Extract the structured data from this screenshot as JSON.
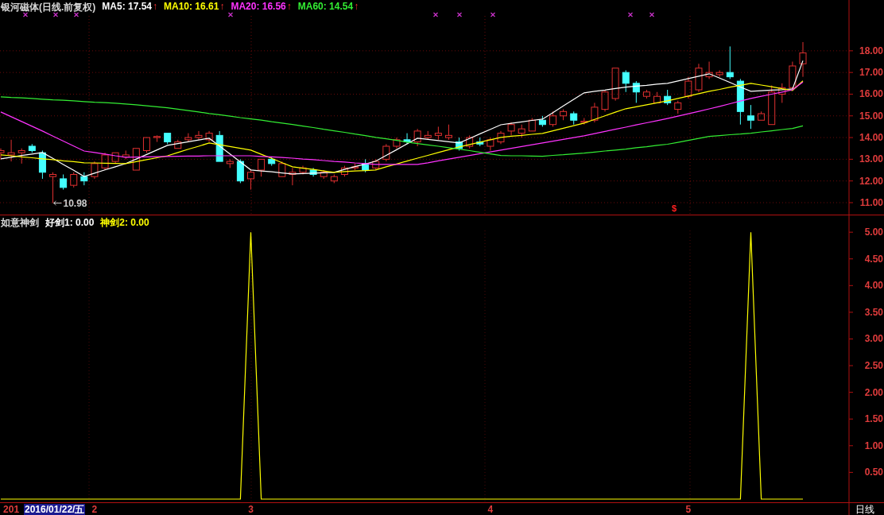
{
  "stock_panel": {
    "title": "银河磁体(日线.前复权)",
    "indicators": [
      {
        "label": "MA5: 17.54",
        "arrow": "↑",
        "color": "#ffffff"
      },
      {
        "label": "MA10: 16.61",
        "arrow": "↑",
        "color": "#ffff00"
      },
      {
        "label": "MA20: 16.56",
        "arrow": "↑",
        "color": "#ff33ff"
      },
      {
        "label": "MA60: 14.54",
        "arrow": "↑",
        "color": "#33ee33"
      }
    ],
    "chart_data": {
      "type": "candlestick",
      "grid": true,
      "ylim": [
        10.45,
        20.34
      ],
      "categories": [
        null,
        null,
        null,
        null,
        null,
        null,
        null,
        null,
        null,
        null,
        null,
        null,
        null,
        null,
        null,
        null,
        null,
        null,
        null,
        null,
        null,
        null,
        null,
        null,
        null,
        null,
        null,
        null,
        null,
        null,
        null,
        null,
        null,
        null,
        null,
        null,
        null,
        null,
        null,
        null,
        null,
        null,
        null,
        null,
        null,
        null,
        null,
        null,
        null,
        null,
        null,
        null,
        null,
        null,
        null,
        null,
        null,
        null,
        null,
        null,
        null,
        null,
        null,
        null,
        null,
        null,
        null,
        null,
        null,
        null,
        null,
        null,
        null,
        null,
        null,
        null,
        null,
        null
      ],
      "yticks": [
        {
          "value": 11,
          "label": "11.00"
        },
        {
          "value": 12,
          "label": "12.00"
        },
        {
          "value": 13,
          "label": "13.00"
        },
        {
          "value": 14,
          "label": "14.00"
        },
        {
          "value": 15,
          "label": "15.00"
        },
        {
          "value": 16,
          "label": "16.00"
        },
        {
          "value": 17,
          "label": "17.00"
        },
        {
          "value": 18,
          "label": "18.00"
        }
      ],
      "ohlc": [
        [
          13.3,
          13.5,
          13.0,
          13.4
        ],
        [
          13.2,
          13.9,
          12.9,
          13.3
        ],
        [
          13.3,
          13.5,
          12.8,
          13.4
        ],
        [
          13.6,
          13.7,
          13.3,
          13.4
        ],
        [
          13.3,
          13.4,
          12.1,
          12.4
        ],
        [
          12.2,
          12.4,
          10.98,
          12.3
        ],
        [
          12.1,
          12.3,
          11.6,
          11.7
        ],
        [
          11.8,
          12.4,
          11.7,
          12.3
        ],
        [
          12.2,
          12.4,
          11.8,
          12.0
        ],
        [
          12.2,
          12.9,
          12.1,
          12.8
        ],
        [
          12.6,
          13.3,
          12.5,
          13.2
        ],
        [
          12.9,
          13.3,
          12.8,
          13.3
        ],
        [
          13.1,
          13.4,
          13.0,
          13.2
        ],
        [
          12.5,
          13.5,
          12.5,
          13.5
        ],
        [
          13.4,
          14.0,
          13.3,
          14.0
        ],
        [
          14.0,
          14.1,
          13.8,
          14.05
        ],
        [
          14.2,
          14.2,
          13.7,
          13.8
        ],
        [
          13.5,
          13.9,
          13.5,
          13.8
        ],
        [
          13.9,
          14.2,
          13.8,
          14.0
        ],
        [
          14.0,
          14.3,
          13.9,
          14.1
        ],
        [
          13.9,
          14.3,
          13.8,
          14.2
        ],
        [
          14.1,
          14.3,
          12.9,
          12.9
        ],
        [
          12.8,
          13.0,
          12.6,
          12.9
        ],
        [
          12.9,
          13.0,
          11.9,
          12.0
        ],
        [
          12.1,
          12.5,
          11.6,
          12.4
        ],
        [
          12.5,
          13.0,
          12.2,
          13.0
        ],
        [
          13.0,
          13.1,
          12.7,
          12.8
        ],
        [
          12.2,
          12.9,
          12.2,
          12.8
        ],
        [
          12.3,
          12.6,
          11.8,
          12.4
        ],
        [
          12.4,
          12.7,
          12.3,
          12.6
        ],
        [
          12.5,
          12.6,
          12.2,
          12.3
        ],
        [
          12.2,
          12.5,
          12.1,
          12.4
        ],
        [
          12.0,
          12.3,
          11.9,
          12.2
        ],
        [
          12.3,
          12.7,
          12.2,
          12.6
        ],
        [
          12.6,
          12.8,
          12.5,
          12.65
        ],
        [
          12.8,
          13.0,
          12.4,
          12.5
        ],
        [
          12.6,
          13.0,
          12.5,
          12.9
        ],
        [
          13.0,
          13.7,
          12.9,
          13.6
        ],
        [
          13.6,
          14.0,
          13.5,
          13.9
        ],
        [
          13.9,
          14.2,
          13.7,
          13.8
        ],
        [
          13.8,
          14.4,
          13.6,
          14.3
        ],
        [
          14.0,
          14.3,
          13.9,
          14.1
        ],
        [
          14.1,
          14.5,
          13.9,
          14.2
        ],
        [
          14.0,
          14.6,
          13.9,
          14.1
        ],
        [
          13.8,
          14.0,
          13.4,
          13.5
        ],
        [
          13.6,
          14.1,
          13.5,
          14.0
        ],
        [
          13.8,
          14.0,
          13.6,
          13.7
        ],
        [
          13.6,
          14.0,
          13.4,
          13.9
        ],
        [
          13.8,
          14.3,
          13.7,
          14.2
        ],
        [
          14.3,
          14.7,
          14.1,
          14.6
        ],
        [
          14.2,
          14.6,
          14.0,
          14.4
        ],
        [
          14.3,
          14.9,
          14.3,
          14.8
        ],
        [
          14.8,
          15.0,
          14.5,
          14.6
        ],
        [
          14.6,
          15.2,
          14.5,
          15.0
        ],
        [
          15.0,
          15.3,
          14.8,
          15.2
        ],
        [
          15.1,
          15.2,
          14.6,
          14.8
        ],
        [
          14.7,
          14.9,
          14.6,
          14.75
        ],
        [
          14.8,
          15.6,
          14.7,
          15.4
        ],
        [
          15.3,
          16.2,
          15.2,
          16.1
        ],
        [
          15.8,
          17.2,
          15.7,
          17.2
        ],
        [
          17.0,
          17.1,
          16.1,
          16.5
        ],
        [
          16.5,
          16.6,
          15.6,
          16.1
        ],
        [
          15.9,
          16.2,
          15.8,
          16.1
        ],
        [
          15.6,
          16.1,
          15.6,
          15.9
        ],
        [
          15.9,
          16.2,
          15.5,
          15.6
        ],
        [
          15.3,
          15.7,
          15.1,
          15.6
        ],
        [
          15.9,
          16.8,
          15.8,
          16.6
        ],
        [
          16.2,
          17.4,
          16.1,
          17.2
        ],
        [
          16.8,
          17.5,
          16.7,
          17.0
        ],
        [
          16.9,
          17.1,
          16.8,
          17.0
        ],
        [
          17.0,
          18.2,
          16.7,
          16.8
        ],
        [
          16.6,
          16.7,
          14.6,
          15.2
        ],
        [
          15.0,
          15.5,
          14.4,
          14.8
        ],
        [
          14.8,
          15.2,
          14.8,
          15.1
        ],
        [
          14.6,
          16.4,
          14.6,
          16.1
        ],
        [
          16.0,
          16.5,
          15.6,
          16.3
        ],
        [
          16.3,
          17.5,
          16.2,
          17.3
        ],
        [
          17.4,
          18.4,
          16.8,
          17.9
        ]
      ],
      "series": [
        {
          "type": "line",
          "color": "#ffffff",
          "values": [
            13.02,
            13.09,
            13.17,
            13.24,
            13.31,
            13.04,
            12.76,
            12.49,
            12.21,
            12.36,
            12.51,
            12.65,
            12.8,
            13.01,
            13.22,
            13.43,
            13.64,
            13.72,
            13.81,
            13.89,
            13.97,
            13.61,
            13.24,
            12.88,
            12.51,
            12.46,
            12.42,
            12.37,
            12.32,
            12.34,
            12.36,
            12.38,
            12.4,
            12.53,
            12.66,
            12.78,
            12.91,
            13.18,
            13.44,
            13.71,
            13.97,
            13.92,
            13.86,
            13.81,
            13.75,
            13.96,
            14.17,
            14.38,
            14.59,
            14.66,
            14.72,
            14.79,
            14.85,
            15.15,
            15.46,
            15.76,
            16.06,
            16.13,
            16.19,
            16.26,
            16.32,
            16.37,
            16.41,
            16.46,
            16.5,
            16.61,
            16.72,
            16.83,
            16.94,
            16.74,
            16.54,
            16.33,
            16.13,
            16.16,
            16.19,
            16.21,
            16.24,
            17.54
          ]
        },
        {
          "type": "line",
          "color": "#ffff00",
          "values": [
            13.2,
            13.16,
            13.11,
            13.07,
            13.02,
            12.98,
            12.93,
            12.89,
            12.84,
            12.83,
            12.82,
            12.81,
            12.8,
            12.89,
            12.98,
            13.07,
            13.16,
            13.31,
            13.46,
            13.6,
            13.75,
            13.67,
            13.59,
            13.5,
            13.42,
            13.23,
            13.04,
            12.84,
            12.65,
            12.59,
            12.53,
            12.46,
            12.4,
            12.43,
            12.46,
            12.48,
            12.51,
            12.65,
            12.78,
            12.92,
            13.05,
            13.18,
            13.31,
            13.44,
            13.57,
            13.68,
            13.79,
            13.9,
            14.01,
            14.06,
            14.1,
            14.15,
            14.19,
            14.31,
            14.43,
            14.55,
            14.67,
            14.84,
            15.0,
            15.17,
            15.33,
            15.42,
            15.51,
            15.6,
            15.69,
            15.8,
            15.91,
            16.02,
            16.13,
            16.22,
            16.32,
            16.41,
            16.5,
            16.42,
            16.34,
            16.25,
            16.17,
            16.61
          ]
        },
        {
          "type": "line",
          "color": "#ff33ff",
          "values": [
            15.18,
            14.96,
            14.74,
            14.52,
            14.3,
            14.07,
            13.84,
            13.61,
            13.38,
            13.31,
            13.24,
            13.16,
            13.09,
            13.1,
            13.11,
            13.12,
            13.13,
            13.14,
            13.15,
            13.15,
            13.16,
            13.16,
            13.16,
            13.16,
            13.16,
            13.13,
            13.11,
            13.08,
            13.05,
            13.01,
            12.98,
            12.94,
            12.9,
            12.87,
            12.83,
            12.8,
            12.76,
            12.76,
            12.76,
            12.76,
            12.76,
            12.84,
            12.93,
            13.01,
            13.09,
            13.17,
            13.26,
            13.34,
            13.42,
            13.5,
            13.59,
            13.67,
            13.75,
            13.83,
            13.92,
            14.0,
            14.08,
            14.18,
            14.28,
            14.38,
            14.48,
            14.58,
            14.68,
            14.78,
            14.88,
            14.99,
            15.1,
            15.21,
            15.32,
            15.44,
            15.56,
            15.68,
            15.8,
            15.9,
            16.0,
            16.1,
            16.2,
            16.56
          ]
        },
        {
          "type": "line",
          "color": "#33ee33",
          "values": [
            15.88,
            15.85,
            15.83,
            15.8,
            15.77,
            15.74,
            15.72,
            15.69,
            15.66,
            15.63,
            15.61,
            15.58,
            15.55,
            15.51,
            15.46,
            15.42,
            15.37,
            15.31,
            15.24,
            15.18,
            15.11,
            15.05,
            14.99,
            14.92,
            14.86,
            14.8,
            14.73,
            14.67,
            14.6,
            14.53,
            14.46,
            14.38,
            14.31,
            14.24,
            14.16,
            14.09,
            14.01,
            13.94,
            13.87,
            13.79,
            13.72,
            13.66,
            13.6,
            13.53,
            13.47,
            13.4,
            13.32,
            13.25,
            13.17,
            13.16,
            13.16,
            13.15,
            13.14,
            13.18,
            13.21,
            13.25,
            13.28,
            13.33,
            13.38,
            13.42,
            13.47,
            13.53,
            13.58,
            13.64,
            13.69,
            13.78,
            13.87,
            13.96,
            14.05,
            14.09,
            14.13,
            14.16,
            14.2,
            14.26,
            14.31,
            14.37,
            14.42,
            14.54
          ]
        }
      ],
      "annotations": [
        "10.98"
      ]
    },
    "signal_mark": "$"
  },
  "indicator_panel": {
    "title": "如意神剑",
    "values": [
      {
        "label": "好剑1: 0.00",
        "color": "#ffffff"
      },
      {
        "label": "神剑2: 0.00",
        "color": "#ffff00"
      }
    ],
    "chart_data": {
      "type": "line",
      "ylim": [
        -0.06,
        5.33
      ],
      "categories": [
        null,
        "201",
        null,
        null,
        null,
        null,
        null,
        null,
        null,
        "2",
        null,
        null,
        null,
        null,
        null,
        null,
        null,
        null,
        null,
        null,
        null,
        null,
        null,
        null,
        "3",
        null,
        null,
        null,
        null,
        null,
        null,
        null,
        null,
        null,
        null,
        null,
        null,
        null,
        null,
        null,
        null,
        null,
        null,
        null,
        null,
        null,
        null,
        "4",
        null,
        null,
        null,
        null,
        null,
        null,
        null,
        null,
        null,
        null,
        null,
        null,
        null,
        null,
        null,
        null,
        null,
        null,
        "5",
        null,
        null,
        null,
        null,
        null,
        null,
        null,
        null,
        null,
        null,
        null
      ],
      "yticks": [
        {
          "value": 0.5,
          "label": "0.50"
        },
        {
          "value": 1,
          "label": "1.00"
        },
        {
          "value": 1.5,
          "label": "1.50"
        },
        {
          "value": 2,
          "label": "2.00"
        },
        {
          "value": 2.5,
          "label": "2.50"
        },
        {
          "value": 3,
          "label": "3.00"
        },
        {
          "value": 3.5,
          "label": "3.50"
        },
        {
          "value": 4,
          "label": "4.00"
        },
        {
          "value": 4.5,
          "label": "4.50"
        },
        {
          "value": 5,
          "label": "5.00"
        }
      ],
      "series": [
        {
          "color": "#ffff00",
          "values": [
            0,
            0,
            0,
            0,
            0,
            0,
            0,
            0,
            0,
            0,
            0,
            0,
            0,
            0,
            0,
            0,
            0,
            0,
            0,
            0,
            0,
            0,
            0,
            0,
            5,
            0,
            0,
            0,
            0,
            0,
            0,
            0,
            0,
            0,
            0,
            0,
            0,
            0,
            0,
            0,
            0,
            0,
            0,
            0,
            0,
            0,
            0,
            0,
            0,
            0,
            0,
            0,
            0,
            0,
            0,
            0,
            0,
            0,
            0,
            0,
            0,
            0,
            0,
            0,
            0,
            0,
            0,
            0,
            0,
            0,
            0,
            0,
            5,
            0,
            0,
            0,
            0,
            0
          ]
        }
      ]
    }
  },
  "time_axis": {
    "cursor_date": "2016/01/22/五",
    "period": "日线"
  }
}
